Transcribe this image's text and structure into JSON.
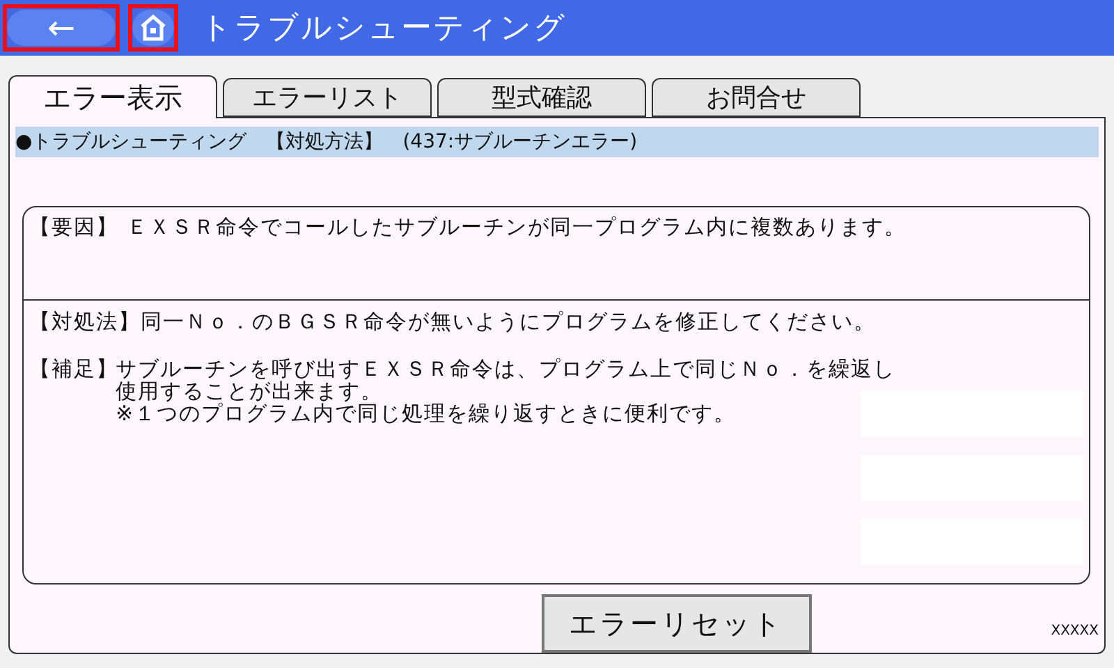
{
  "header": {
    "title": "トラブルシューティング",
    "back_button": {
      "label": "←",
      "highlighted": true
    },
    "home_button": {
      "highlighted": true
    }
  },
  "tabs": [
    {
      "label": "エラー表示",
      "selected": true
    },
    {
      "label": "エラーリスト",
      "selected": false
    },
    {
      "label": "型式確認",
      "selected": false
    },
    {
      "label": "お問合せ",
      "selected": false
    }
  ],
  "section_title": "●トラブルシューティング　【対処方法】　(437:サブルーチンエラー)",
  "cause": "【要因】 ＥＸＳＲ命令でコールしたサブルーチンが同一プログラム内に複数あります。",
  "remedy": "【対処法】同一Ｎｏ．のＢＧＳＲ命令が無いようにプログラムを修正してください。",
  "supplement": {
    "label": "【補足】",
    "lines": [
      "サブルーチンを呼び出すＥＸＳＲ命令は、プログラム上で同じＮｏ．を繰返し",
      "使用することが出来ます。",
      "※１つのプログラム内で同じ処理を繰り返すときに便利です。"
    ]
  },
  "reset_button": "エラーリセット",
  "footer_code": "XXXXX"
}
